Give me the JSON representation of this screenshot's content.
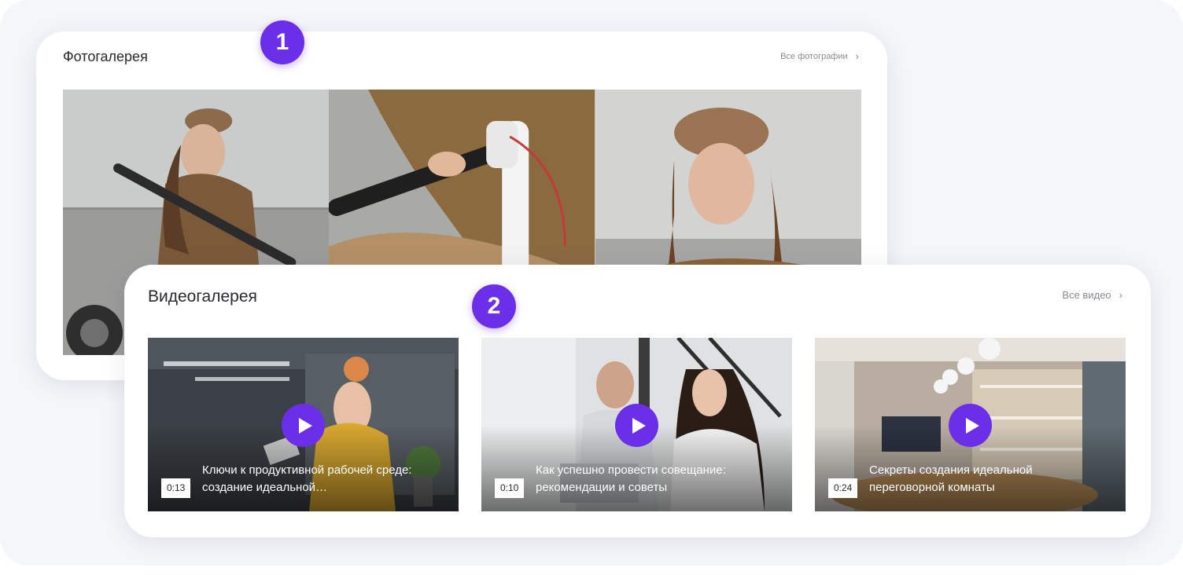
{
  "photo_gallery": {
    "title": "Фотогалерея",
    "see_all_label": "Все фотографии",
    "see_all_icon": "chevron-right-icon",
    "badge": "1",
    "photos": [
      {
        "subject": "woman-with-scooter"
      },
      {
        "subject": "hands-on-scooter"
      },
      {
        "subject": "woman-in-cap"
      }
    ]
  },
  "video_gallery": {
    "title": "Видеогалерея",
    "see_all_label": "Все видео",
    "see_all_icon": "chevron-right-icon",
    "badge": "2",
    "videos": [
      {
        "duration": "0:13",
        "title": "Ключи к продуктивной рабочей среде: создание идеальной…"
      },
      {
        "duration": "0:10",
        "title": "Как успешно провести совещание: рекомендации и советы"
      },
      {
        "duration": "0:24",
        "title": "Секреты создания идеальной переговорной комнаты"
      }
    ]
  },
  "colors": {
    "accent": "#6a2fe6",
    "background": "#f5f6fa",
    "card": "#ffffff"
  }
}
